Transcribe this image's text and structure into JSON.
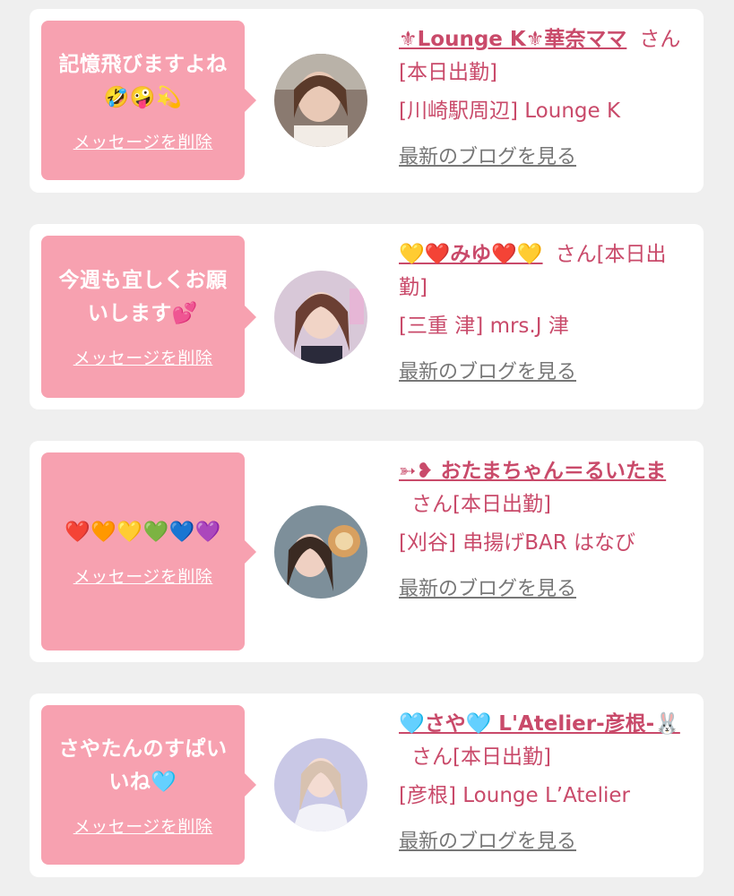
{
  "cards": [
    {
      "message": "記憶飛びますよね🤣🤪💫",
      "delete_label": "メッセージを削除",
      "name": "⚜Lounge K⚜華奈ママ",
      "suffix": "さん[本日出勤]",
      "area": "[川崎駅周辺] Lounge K",
      "blog_label": "最新のブログを見る"
    },
    {
      "message": "今週も宜しくお願いします💕",
      "delete_label": "メッセージを削除",
      "name": "💛❤️みゆ❤️💛",
      "suffix": "さん[本日出勤]",
      "area": "[三重 津] mrs.J 津",
      "blog_label": "最新のブログを見る"
    },
    {
      "message": "❤️🧡💛💚💙💜",
      "delete_label": "メッセージを削除",
      "name": "➳❥ おたまちゃん＝るいたま",
      "suffix": "さん[本日出勤]",
      "area": "[刈谷] 串揚げBAR はなび",
      "blog_label": "最新のブログを見る"
    },
    {
      "message": "さやたんのすぱいいね🩵",
      "delete_label": "メッセージを削除",
      "name": "🩵さや🩵 L'Atelier-彦根-🐰",
      "suffix": "さん[本日出勤]",
      "area": "[彦根] Lounge L’Atelier",
      "blog_label": "最新のブログを見る"
    }
  ],
  "colors": {
    "bubble": "#f7a1b0",
    "name": "#c94a6a",
    "link_gray": "#777777",
    "background": "#efefef"
  }
}
